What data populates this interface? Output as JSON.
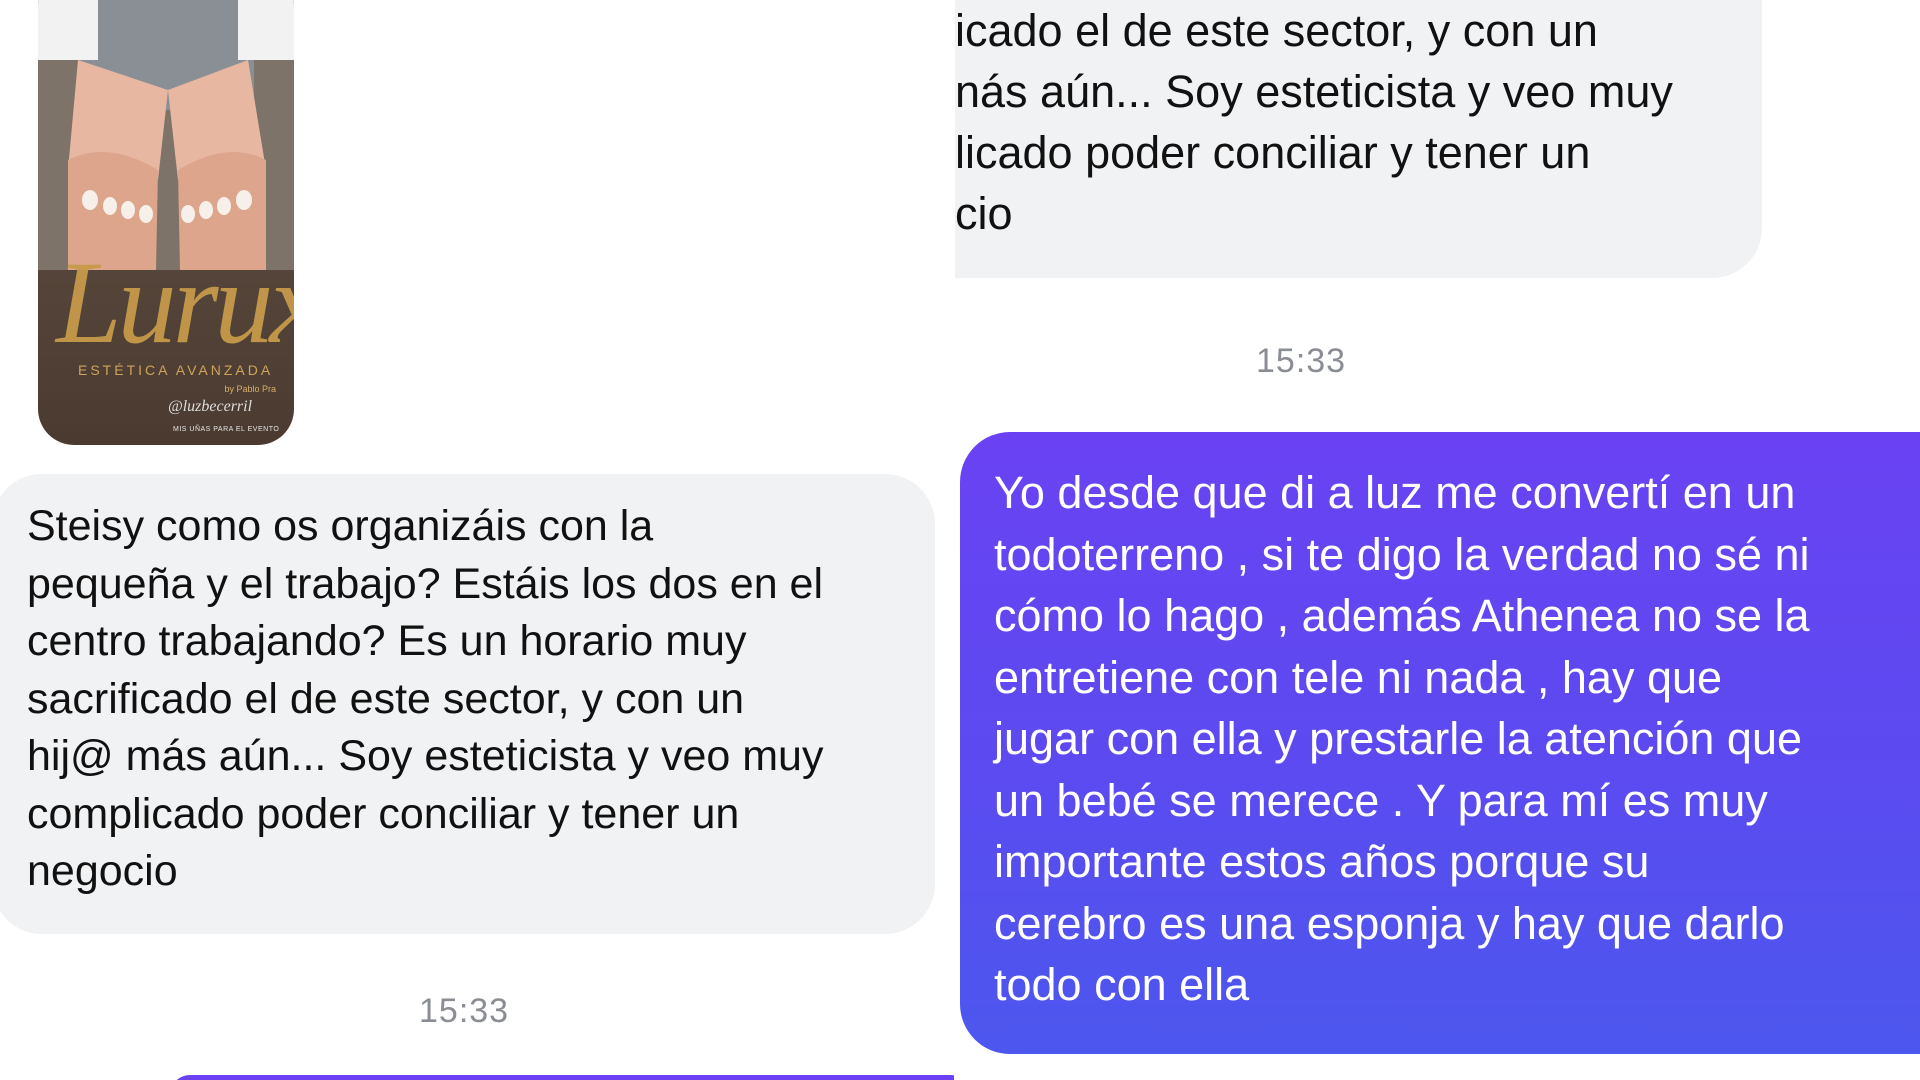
{
  "left": {
    "story": {
      "logo_text": "Lurux",
      "tagline": "ESTÉTICA AVANZADA",
      "byline": "by Pablo Pra",
      "handle": "@luzbecerril",
      "caption": "MIS UÑAS PARA EL EVENTO"
    },
    "message": "Steisy como os organizáis con la\npequeña y el trabajo? Estáis los dos en el\ncentro trabajando? Es un horario muy\nsacrificado el de este sector, y con un\nhij@ más aún... Soy esteticista y veo muy\ncomplicado poder conciliar y tener un\nnegocio",
    "timestamp": "15:33"
  },
  "right": {
    "message_cropped": "icado el de este sector, y con un\nnás aún... Soy esteticista y veo muy\nlicado poder conciliar y tener un\ncio",
    "timestamp": "15:33",
    "reply": "Yo desde que di a luz me convertí en un\ntodoterreno , si te digo la verdad no sé ni\ncómo lo hago , además Athenea no se la\nentretiene con tele ni nada , hay que\njugar con ella y prestarle la atención que\nun bebé se merece . Y para mí es muy\nimportante estos años porque su\ncerebro es una esponja y hay que darlo\ntodo con ella"
  },
  "colors": {
    "incoming_bubble": "#f1f2f4",
    "outgoing_bubble_top": "#6a42f3",
    "outgoing_bubble_bottom": "#4c57ee",
    "timestamp": "#8a8d93"
  }
}
